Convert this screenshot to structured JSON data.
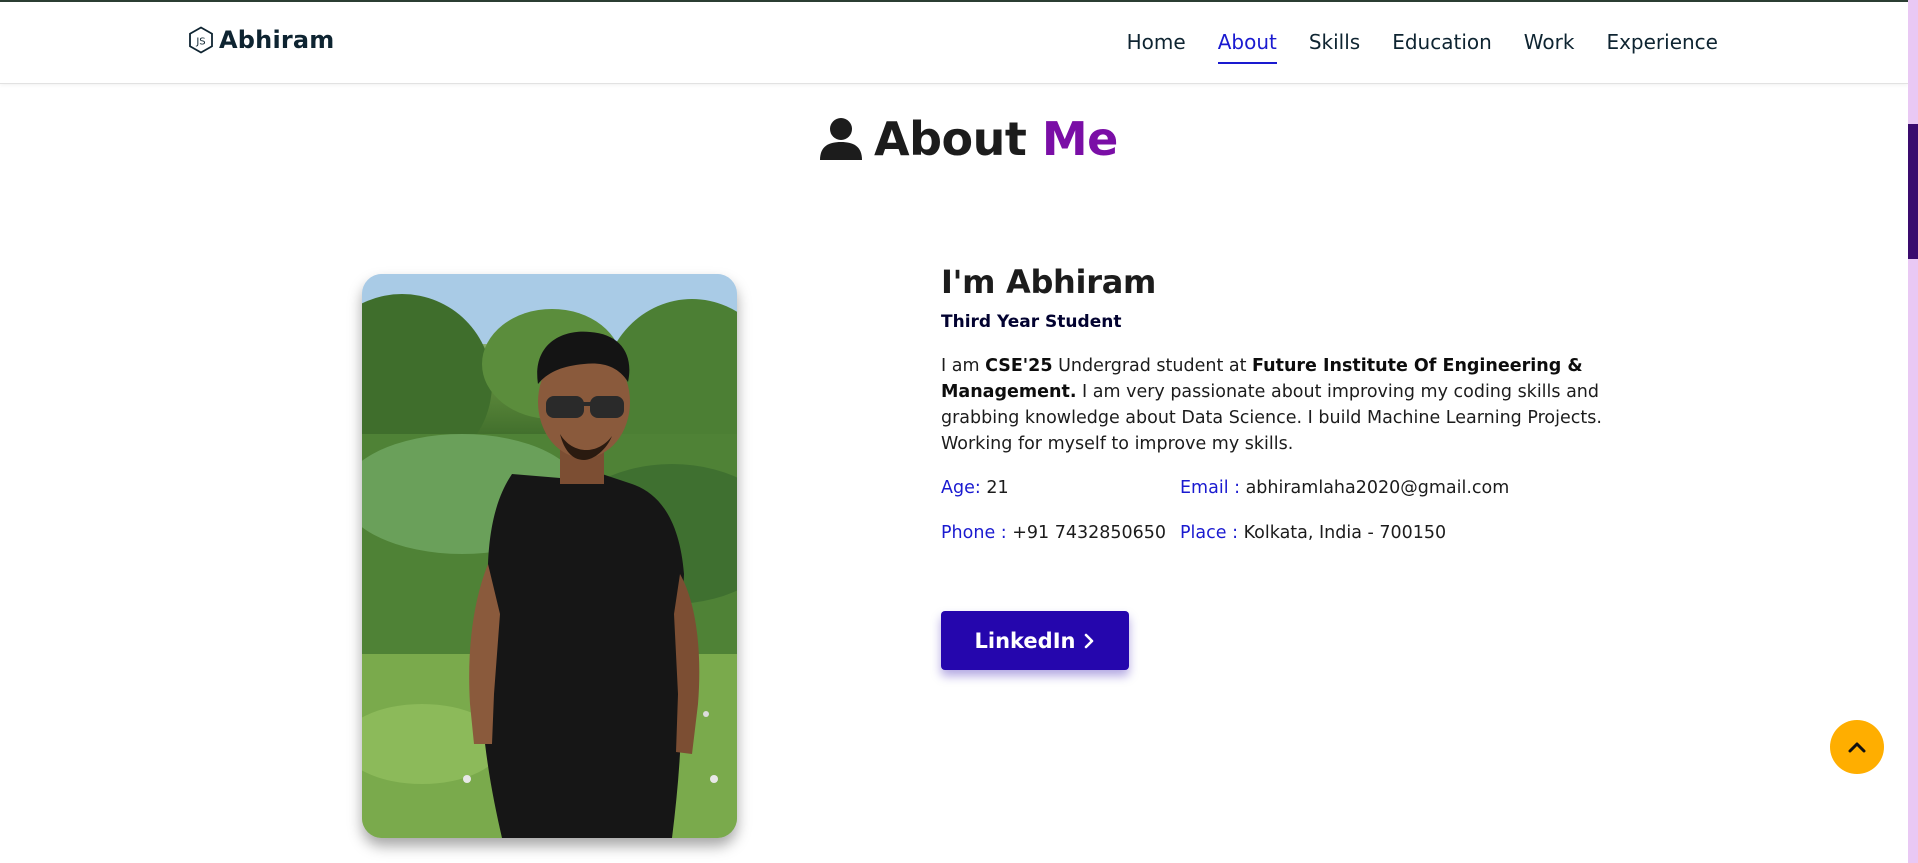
{
  "header": {
    "logo_text": "Abhiram",
    "logo_icon": "js-hexagon-icon",
    "nav": [
      {
        "label": "Home",
        "active": false
      },
      {
        "label": "About",
        "active": true
      },
      {
        "label": "Skills",
        "active": false
      },
      {
        "label": "Education",
        "active": false
      },
      {
        "label": "Work",
        "active": false
      },
      {
        "label": "Experience",
        "active": false
      }
    ]
  },
  "section": {
    "title_icon": "user-icon",
    "title_main": "About",
    "title_accent": "Me"
  },
  "about": {
    "name": "I'm Abhiram",
    "role": "Third Year Student",
    "desc_parts": {
      "p1": "I am ",
      "b1": "CSE'25",
      "p2": " Undergrad student at ",
      "b2": "Future Institute Of Engineering & Management.",
      "p3": " I am very passionate about improving my coding skills and grabbing knowledge about Data Science. I build Machine Learning Projects. Working for myself to improve my skills."
    },
    "age_label": "Age:",
    "age_value": " 21",
    "email_label": "Email :",
    "email_value": " abhiramlaha2020@gmail.com",
    "phone_label": "Phone :",
    "phone_value": " +91 7432850650",
    "place_label": "Place :",
    "place_value": " Kolkata, India - 700150",
    "button_label": "LinkedIn",
    "button_icon": "chevron-right-icon"
  },
  "scroll_top_icon": "chevron-up-icon",
  "colors": {
    "accent_blue": "#1a1ad0",
    "title_accent": "#7a0ea6",
    "button_bg": "#2506ad",
    "scroll_top_bg": "#ffae00",
    "scrollbar_track": "#e9c8f4",
    "scrollbar_thumb": "#3a0b6e"
  }
}
